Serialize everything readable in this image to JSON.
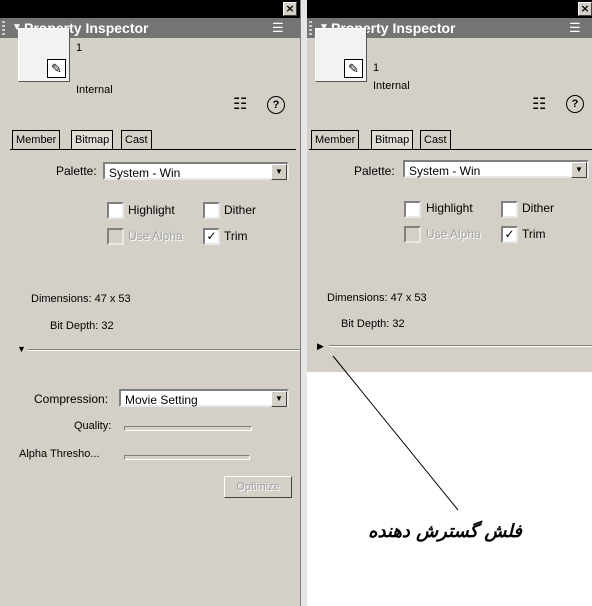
{
  "panels": [
    {
      "title": "Property Inspector",
      "menu_icon": "menu-icon",
      "member": {
        "number": "1",
        "type": "Internal"
      },
      "tabs": [
        "Member",
        "Bitmap",
        "Cast"
      ],
      "active_tab": "Bitmap",
      "palette_label": "Palette:",
      "palette_value": "System - Win",
      "highlight_label": "Highlight",
      "dither_label": "Dither",
      "use_alpha_label": "Use Alpha",
      "trim_label": "Trim",
      "trim_checked": true,
      "dimensions": "Dimensions: 47 x 53",
      "bit_depth": "Bit Depth: 32",
      "expanded": true,
      "compression_label": "Compression:",
      "compression_value": "Movie Setting",
      "quality_label": "Quality:",
      "alpha_threshold_label": "Alpha Thresho...",
      "optimize_label": "Optimize"
    },
    {
      "title": "Property Inspector",
      "member": {
        "number": "1",
        "type": "Internal"
      },
      "tabs": [
        "Member",
        "Bitmap",
        "Cast"
      ],
      "active_tab": "Bitmap",
      "palette_label": "Palette:",
      "palette_value": "System - Win",
      "highlight_label": "Highlight",
      "dither_label": "Dither",
      "use_alpha_label": "Use Alpha",
      "trim_label": "Trim",
      "trim_checked": true,
      "dimensions": "Dimensions: 47 x 53",
      "bit_depth": "Bit Depth: 32",
      "expanded": false
    }
  ],
  "annotation": "فلش گسترش دهنده",
  "colors": {
    "header_bg": "#747474",
    "titlebar_bg": "#000000",
    "panel_bg": "#d4d0c8"
  }
}
